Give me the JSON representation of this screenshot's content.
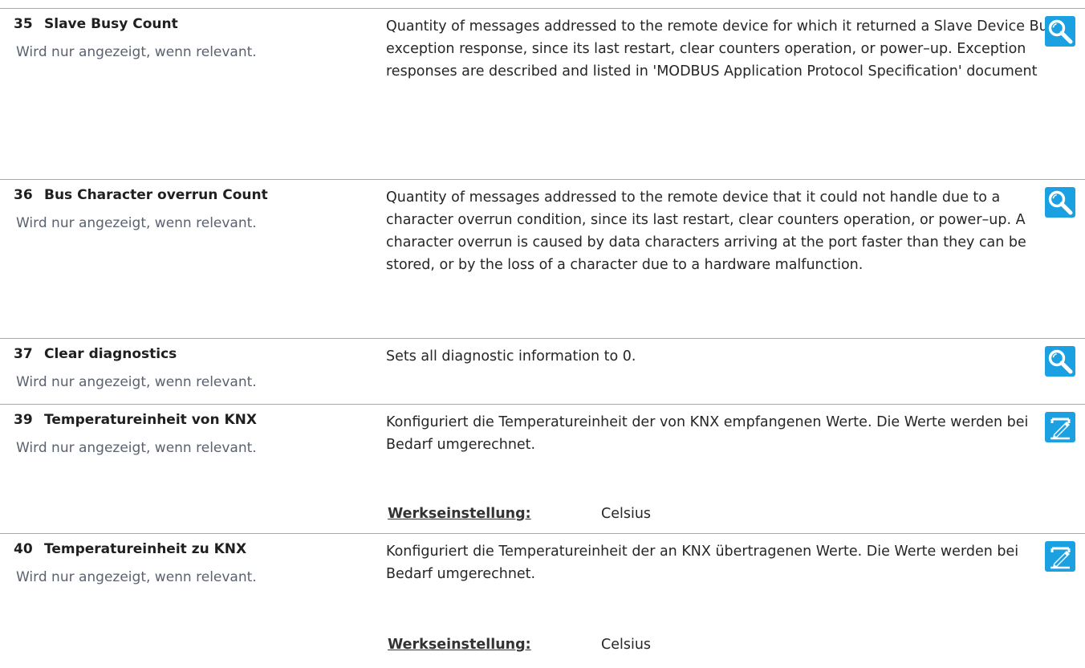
{
  "colors": {
    "icon_background": "#1ba1e2",
    "icon_foreground": "#ffffff",
    "divider": "#a8a8a8",
    "note_text": "#5a6270"
  },
  "default_label": "Werkseinstellung:",
  "rows": [
    {
      "number": "35",
      "title": "Slave Busy Count",
      "note": "Wird nur angezeigt, wenn relevant.",
      "description": "Quantity of messages addressed to the remote device for which it returned a Slave Device Busy exception response, since its last restart, clear counters operation, or power–up. Exception responses are described and listed in 'MODBUS Application Protocol Specification' document",
      "icon": "magnifier-icon"
    },
    {
      "number": "36",
      "title": "Bus Character overrun Count",
      "note": "Wird nur angezeigt, wenn relevant.",
      "description": "Quantity of messages addressed to the remote device that it could not handle due to a character overrun condition, since its last restart, clear counters operation, or power–up. A character overrun is caused by data characters arriving at the port faster than they can be stored, or by the loss of a character due to a hardware malfunction.",
      "icon": "magnifier-icon"
    },
    {
      "number": "37",
      "title": "Clear diagnostics",
      "note": "Wird nur angezeigt, wenn relevant.",
      "description": "Sets all diagnostic information to 0.",
      "icon": "magnifier-icon"
    },
    {
      "number": "39",
      "title": "Temperatureinheit von KNX",
      "note": "Wird nur angezeigt, wenn relevant.",
      "description": "Konfiguriert die Temperatureinheit der von KNX empfangenen Werte. Die Werte werden bei Bedarf umgerechnet.",
      "default_value": "Celsius",
      "icon": "edit-pen-icon"
    },
    {
      "number": "40",
      "title": "Temperatureinheit zu KNX",
      "note": "Wird nur angezeigt, wenn relevant.",
      "description": "Konfiguriert die Temperatureinheit der an KNX übertragenen Werte. Die Werte werden bei Bedarf umgerechnet.",
      "default_value": "Celsius",
      "icon": "edit-pen-icon"
    }
  ]
}
